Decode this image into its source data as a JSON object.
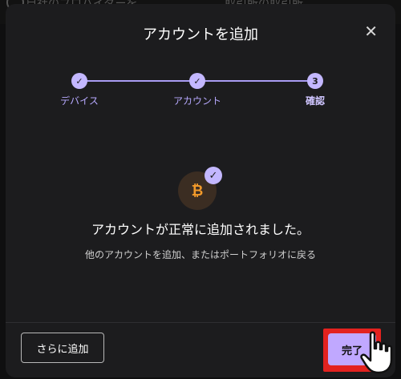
{
  "background": {
    "peek_left": "自社のプロバイダーを",
    "peek_right": "取引所の取引所"
  },
  "modal": {
    "title": "アカウントを追加",
    "close_icon": "close-icon"
  },
  "stepper": {
    "steps": [
      {
        "label": "デバイス",
        "state": "done",
        "marker": "✓"
      },
      {
        "label": "アカウント",
        "state": "done",
        "marker": "✓"
      },
      {
        "label": "確認",
        "state": "active",
        "marker": "3"
      }
    ]
  },
  "success": {
    "coin_icon": "bitcoin-icon",
    "coin_symbol": "₿",
    "check_mark": "✓",
    "message": "アカウントが正常に追加されました。",
    "submessage": "他のアカウントを追加、またはポートフォリオに戻る"
  },
  "footer": {
    "add_more_label": "さらに追加",
    "done_label": "完了"
  },
  "colors": {
    "accent": "#c3b7ff",
    "highlight": "#e3221f",
    "bitcoin": "#f39a2a"
  }
}
